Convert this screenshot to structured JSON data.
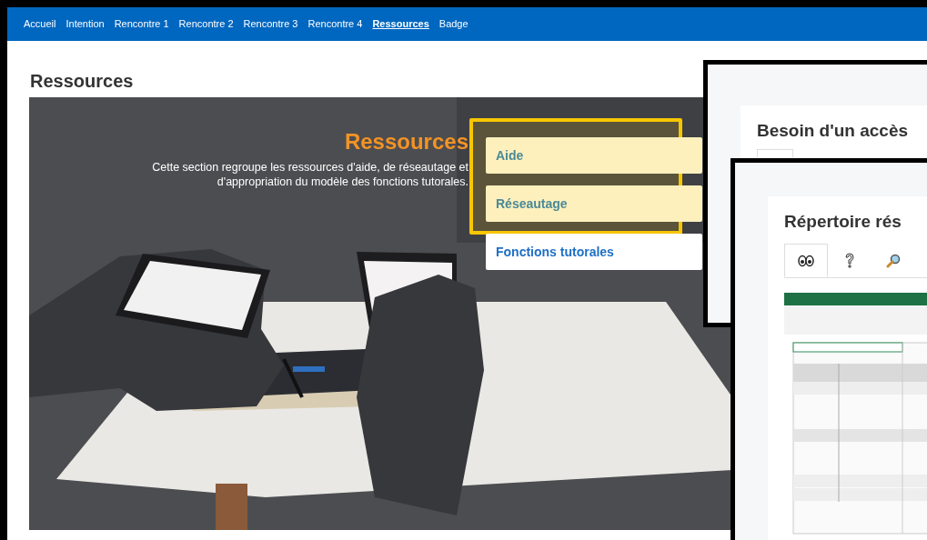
{
  "nav": [
    {
      "label": "Accueil",
      "selected": false
    },
    {
      "label": "Intention",
      "selected": false
    },
    {
      "label": "Rencontre 1",
      "selected": false
    },
    {
      "label": "Rencontre 2",
      "selected": false
    },
    {
      "label": "Rencontre 3",
      "selected": false
    },
    {
      "label": "Rencontre 4",
      "selected": false
    },
    {
      "label": "Ressources",
      "selected": true
    },
    {
      "label": "Badge",
      "selected": false
    }
  ],
  "page_title": "Ressources",
  "hero": {
    "title": "Ressources",
    "description": "Cette section regroupe les ressources d'aide, de réseautage et d'appropriation du modèle des fonctions tutorales."
  },
  "menu": [
    {
      "label": "Aide",
      "highlighted": true
    },
    {
      "label": "Réseautage",
      "highlighted": true
    },
    {
      "label": "Fonctions tutorales",
      "highlighted": false
    }
  ],
  "windows": [
    {
      "title": "Besoin d'un accès"
    },
    {
      "title": "Répertoire rés",
      "tabs": [
        {
          "kind": "eyes",
          "selected": true
        },
        {
          "kind": "question",
          "selected": false
        },
        {
          "kind": "magnifier",
          "selected": false
        }
      ]
    }
  ]
}
